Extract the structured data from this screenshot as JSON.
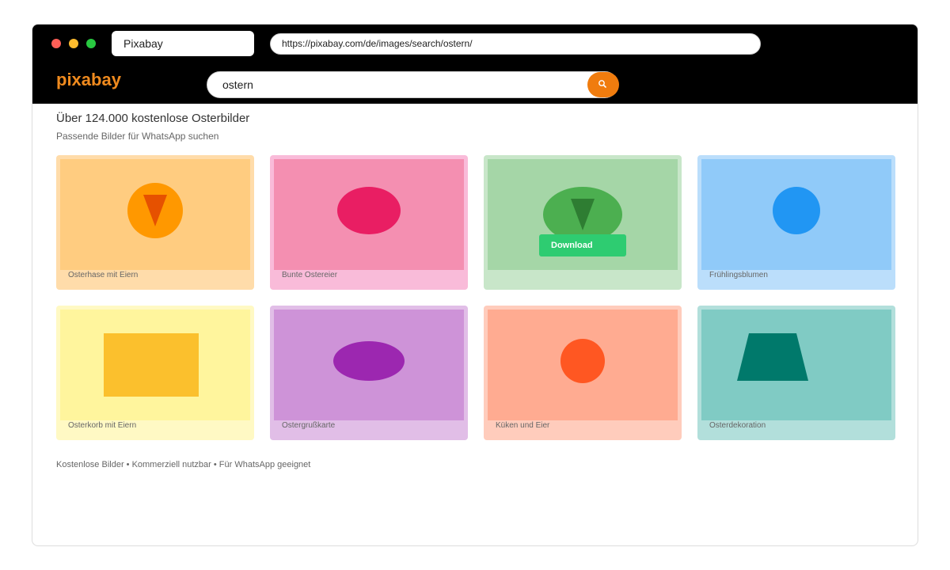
{
  "browser": {
    "tab_title": "Pixabay",
    "url": "https://pixabay.com/de/images/search/ostern/",
    "dot_colors": [
      "#ff5f57",
      "#febc2e",
      "#28c840"
    ]
  },
  "site": {
    "logo": "pixabay",
    "search_value": "ostern",
    "search_icon": "search-icon",
    "accent": "#f07c0e"
  },
  "results": {
    "headline": "Über 124.000 kostenlose Osterbilder",
    "subline": "Passende Bilder für WhatsApp suchen"
  },
  "cards": [
    {
      "caption": "Osterhase mit Eiern",
      "card_color": "#ffdcaa",
      "thumb_color": "#ffcc80",
      "shape": "circle-with-triangle",
      "shape_color": "#ff9800",
      "accent_color": "#e65100"
    },
    {
      "caption": "Bunte Ostereier",
      "card_color": "#f9bbd9",
      "thumb_color": "#f48fb1",
      "shape": "ellipse",
      "shape_color": "#e91e63"
    },
    {
      "caption": "",
      "card_color": "#c8e6c9",
      "thumb_color": "#a5d6a7",
      "shape": "ellipse-with-triangle",
      "shape_color": "#4caf50",
      "accent_color": "#2e7d32",
      "hover_button": "Download",
      "button_color": "#2ecc71"
    },
    {
      "caption": "Frühlingsblumen",
      "card_color": "#bbdefb",
      "thumb_color": "#90caf9",
      "shape": "circle",
      "shape_color": "#2196f3"
    },
    {
      "caption": "Osterkorb mit Eiern",
      "card_color": "#fff9c4",
      "thumb_color": "#fff59d",
      "shape": "rectangle",
      "shape_color": "#fbc02d"
    },
    {
      "caption": "Ostergrußkarte",
      "card_color": "#e1bee7",
      "thumb_color": "#ce93d8",
      "shape": "ellipse",
      "shape_color": "#9c27b0"
    },
    {
      "caption": "Küken und Eier",
      "card_color": "#ffccbc",
      "thumb_color": "#ffab91",
      "shape": "circle",
      "shape_color": "#ff5722"
    },
    {
      "caption": "Osterdekoration",
      "card_color": "#b2dfdb",
      "thumb_color": "#80cbc4",
      "shape": "trapezoid",
      "shape_color": "#00796b"
    }
  ],
  "footer": "Kostenlose Bilder • Kommerziell nutzbar • Für WhatsApp geeignet"
}
